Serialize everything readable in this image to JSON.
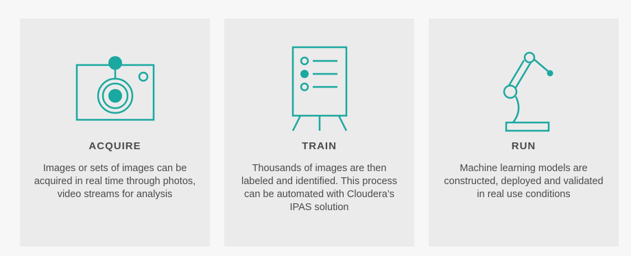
{
  "colors": {
    "accent": "#1aa8a0",
    "card_bg": "#ebebeb",
    "text": "#4a4a4a"
  },
  "cards": [
    {
      "icon": "camera-icon",
      "title": "ACQUIRE",
      "description": "Images or sets of images can be acquired in real time through photos, video streams for analysis"
    },
    {
      "icon": "easel-list-icon",
      "title": "TRAIN",
      "description": "Thousands of images are then labeled and identified. This process can be automated with Cloudera’s IPAS solution"
    },
    {
      "icon": "robotic-arm-icon",
      "title": "RUN",
      "description": "Machine learning models are constructed, deployed and validated in real use conditions"
    }
  ]
}
